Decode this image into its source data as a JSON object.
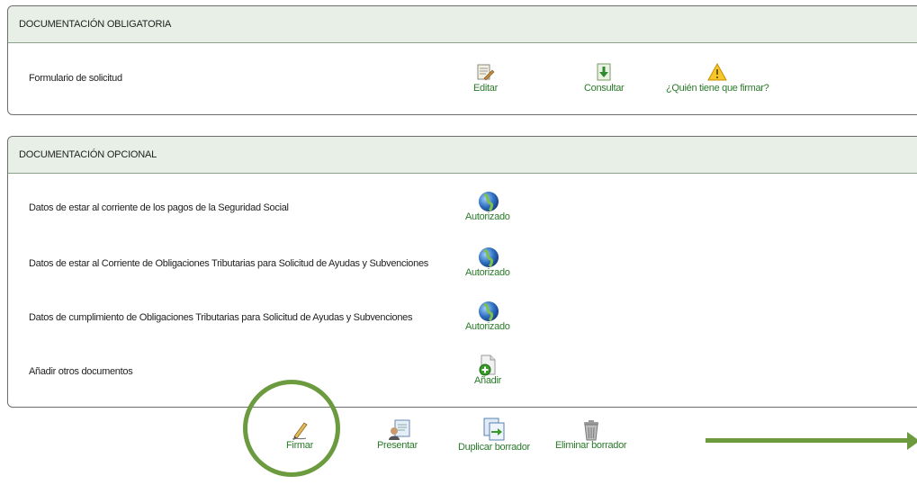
{
  "mandatory": {
    "title": "DOCUMENTACIÓN OBLIGATORIA",
    "rows": [
      {
        "label": "Formulario de solicitud",
        "actions": {
          "edit": "Editar",
          "view": "Consultar",
          "who_signs": "¿Quién tiene que firmar?"
        }
      }
    ]
  },
  "optional": {
    "title": "DOCUMENTACIÓN OPCIONAL",
    "rows": [
      {
        "label": "Datos de estar al corriente de los pagos de la Seguridad Social",
        "action": "Autorizado"
      },
      {
        "label": "Datos de estar al Corriente de Obligaciones Tributarias para Solicitud de Ayudas y Subvenciones",
        "action": "Autorizado"
      },
      {
        "label": "Datos de cumplimiento de Obligaciones Tributarias para Solicitud de Ayudas y Subvenciones",
        "action": "Autorizado"
      },
      {
        "label": "Añadir otros documentos",
        "action": "Añadir"
      }
    ]
  },
  "toolbar": {
    "sign": "Firmar",
    "submit": "Presentar",
    "duplicate": "Duplicar borrador",
    "delete": "Eliminar borrador"
  },
  "colors": {
    "accent_green": "#6b9a3f",
    "link_green": "#2a7a2a",
    "header_bg": "#e7efe7"
  },
  "icons": [
    "edit-icon",
    "download-icon",
    "warning-icon",
    "authorized-globe-icon",
    "add-document-icon",
    "pen-icon",
    "present-icon",
    "duplicate-icon",
    "trash-icon"
  ]
}
